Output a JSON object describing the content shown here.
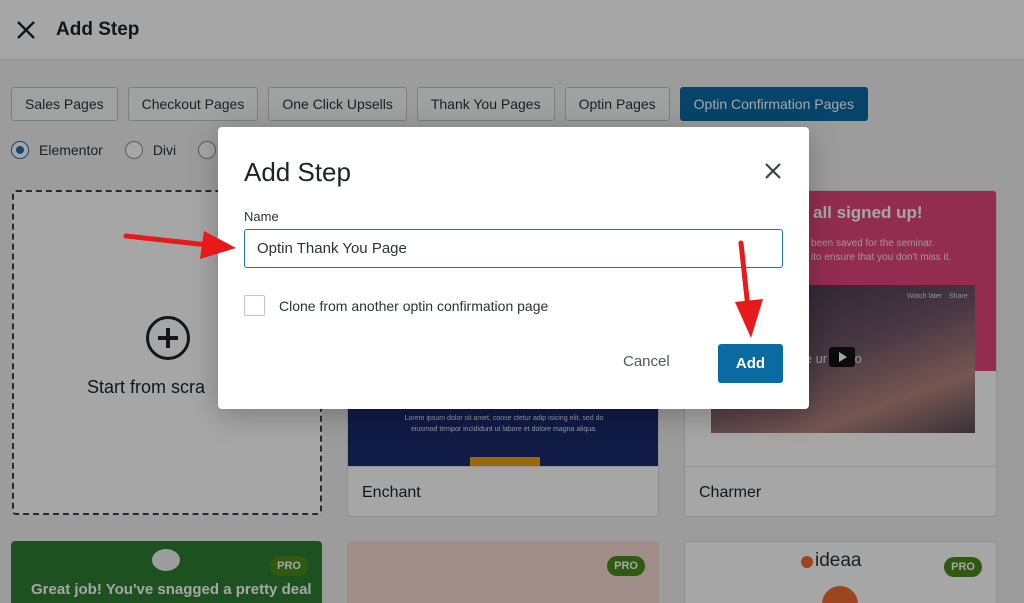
{
  "header": {
    "title": "Add Step",
    "close_icon": "close-icon"
  },
  "tabs": [
    {
      "label": "Sales Pages",
      "active": false
    },
    {
      "label": "Checkout Pages",
      "active": false
    },
    {
      "label": "One Click Upsells",
      "active": false
    },
    {
      "label": "Thank You Pages",
      "active": false
    },
    {
      "label": "Optin Pages",
      "active": false
    },
    {
      "label": "Optin Confirmation Pages",
      "active": true
    }
  ],
  "builders": [
    {
      "label": "Elementor",
      "checked": true
    },
    {
      "label": "Divi",
      "checked": false
    }
  ],
  "scratch": {
    "label": "Start from scra"
  },
  "templates": {
    "enchant": {
      "name": "Enchant",
      "body_text": "Lorem ipsum dolor sit amet, conse ctetur adip isicing elit, sed do eiusmod tempor incididunt ut labore et dolore magna aliqua."
    },
    "charmer": {
      "name": "Charmer",
      "headline": "all signed up!",
      "subtext_1": "been saved for the seminar.",
      "subtext_2": "ito ensure that you don't miss it.",
      "video_text": "ose  ur video",
      "watch_later": "Watch later",
      "share": "Share"
    },
    "green": {
      "text": "Great job! You've snagged a pretty deal",
      "badge": "PRO"
    },
    "peach": {
      "badge": "PRO"
    },
    "ideaa": {
      "logo": "ideaa",
      "badge": "PRO"
    }
  },
  "modal": {
    "title": "Add Step",
    "name_label": "Name",
    "name_value": "Optin Thank You Page",
    "clone_label": "Clone from another optin confirmation page",
    "cancel_label": "Cancel",
    "add_label": "Add"
  },
  "colors": {
    "primary": "#0a6aa1",
    "arrow": "#e8191b",
    "pro_badge": "#4a8a1c"
  }
}
